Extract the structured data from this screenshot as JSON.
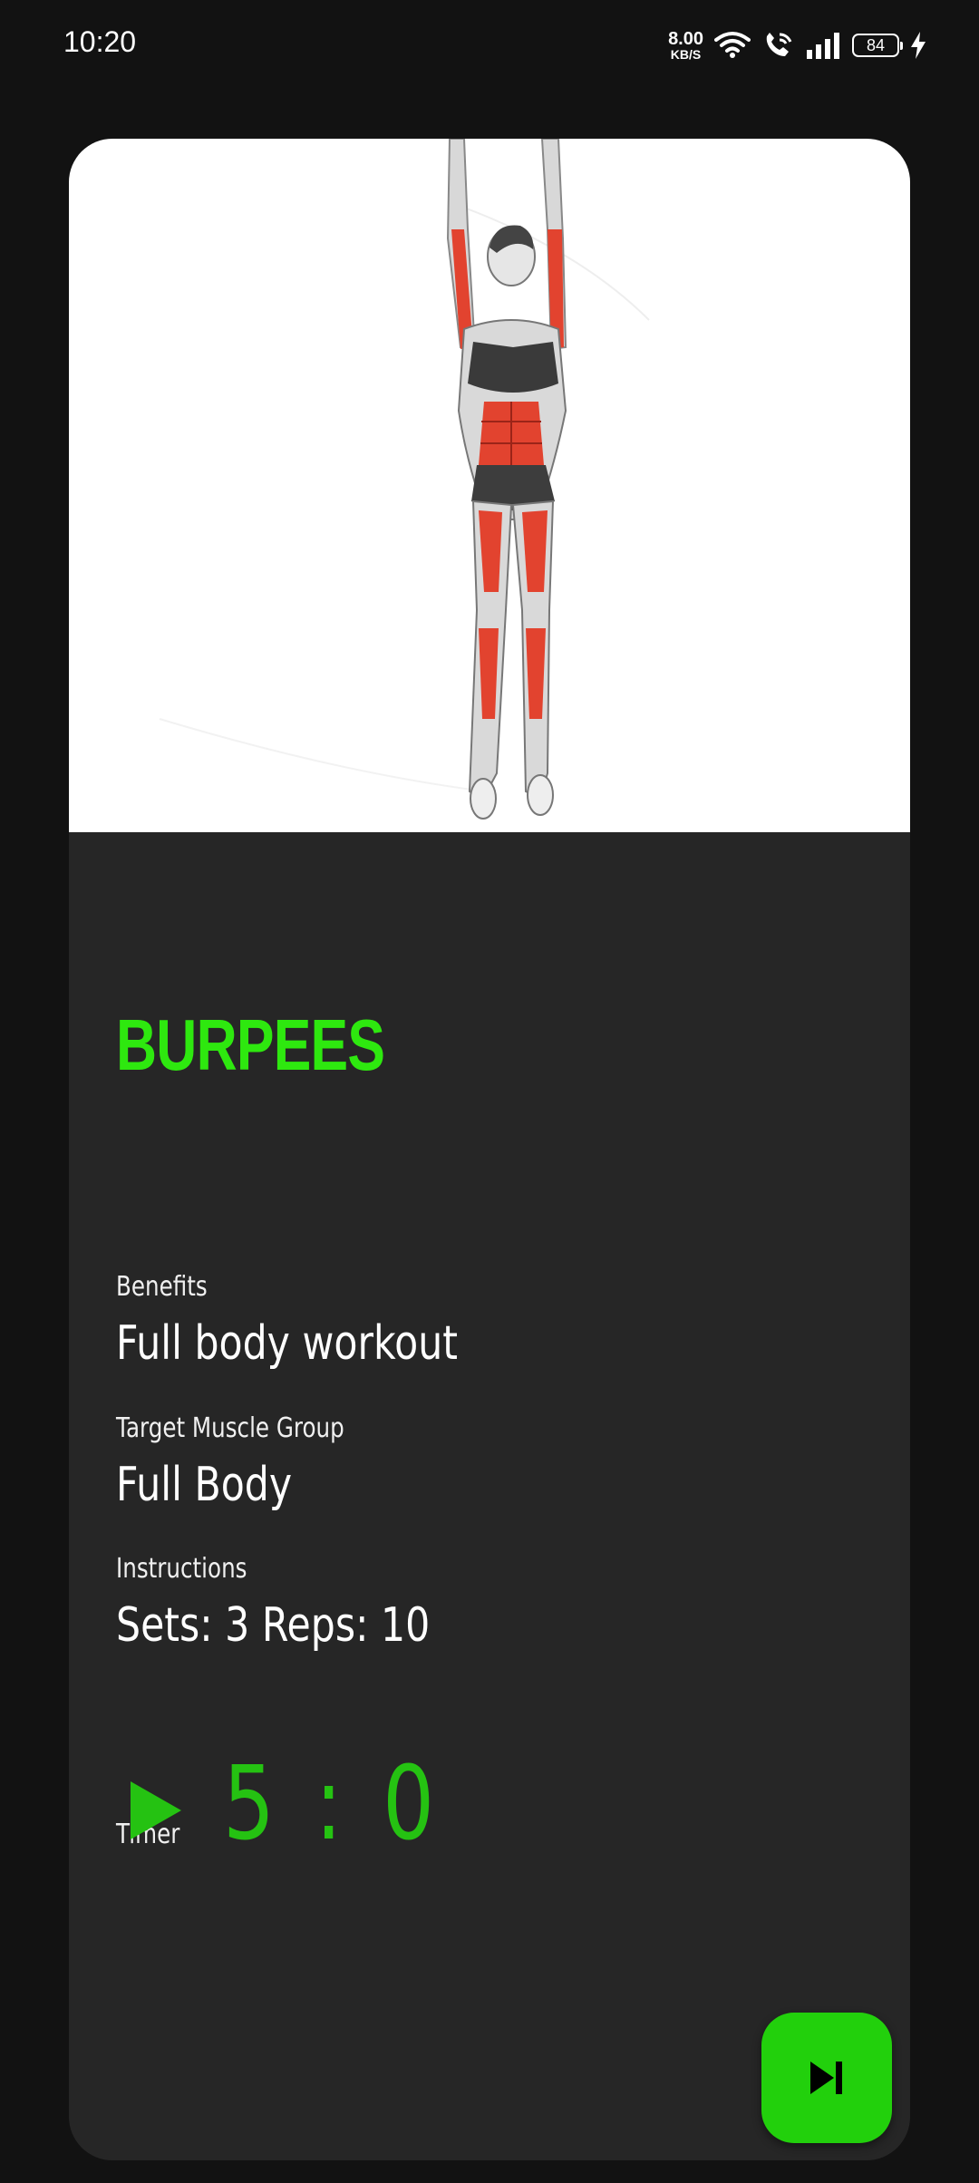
{
  "status_bar": {
    "time": "10:20",
    "net_speed_value": "8.00",
    "net_speed_unit": "KB/S",
    "battery_level": "84"
  },
  "exercise": {
    "title": "BURPEES",
    "benefits_label": "Benefits",
    "benefits_value": "Full body workout",
    "target_label": "Target Muscle Group",
    "target_value": "Full Body",
    "instructions_label": "Instructions",
    "instructions_value": "Sets: 3 Reps: 10"
  },
  "timer": {
    "label": "Timer",
    "value": "5 : 0"
  },
  "colors": {
    "accent_green": "#2ee80f",
    "timer_green": "#25c212",
    "button_green": "#22d00c",
    "card_background": "#262626",
    "page_background": "#121212"
  },
  "icons": {
    "play": "play-icon",
    "skip": "skip-next-icon"
  }
}
